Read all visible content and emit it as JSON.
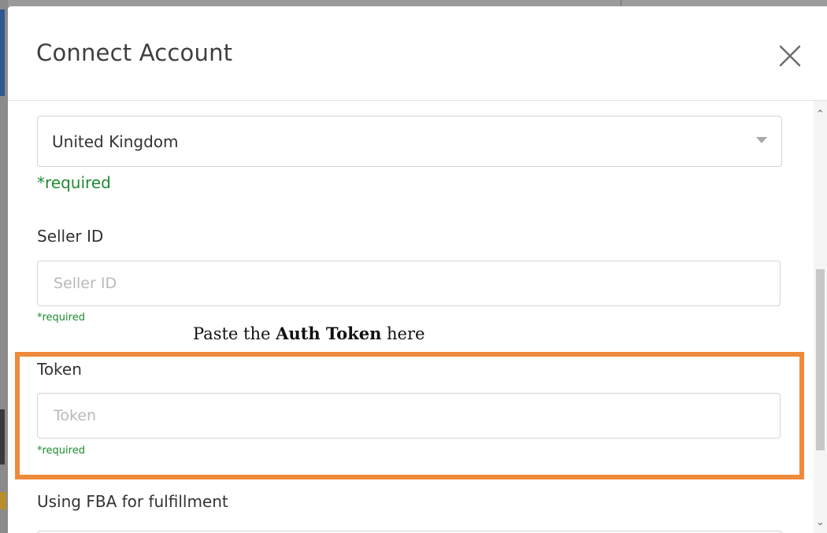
{
  "modal": {
    "title": "Connect Account"
  },
  "form": {
    "marketplace": {
      "selected": "United Kingdom",
      "required_text": "*required"
    },
    "seller_id": {
      "label": "Seller ID",
      "placeholder": "Seller ID",
      "value": "",
      "required_text": "*required"
    },
    "annotation": {
      "prefix": "Paste the ",
      "bold": "Auth Token",
      "suffix": " here"
    },
    "token": {
      "label": "Token",
      "placeholder": "Token",
      "value": "",
      "required_text": "*required"
    },
    "fba": {
      "label": "Using FBA for fulfillment"
    }
  },
  "colors": {
    "required": "#1e8a30",
    "highlight": "#ef8a3a"
  }
}
